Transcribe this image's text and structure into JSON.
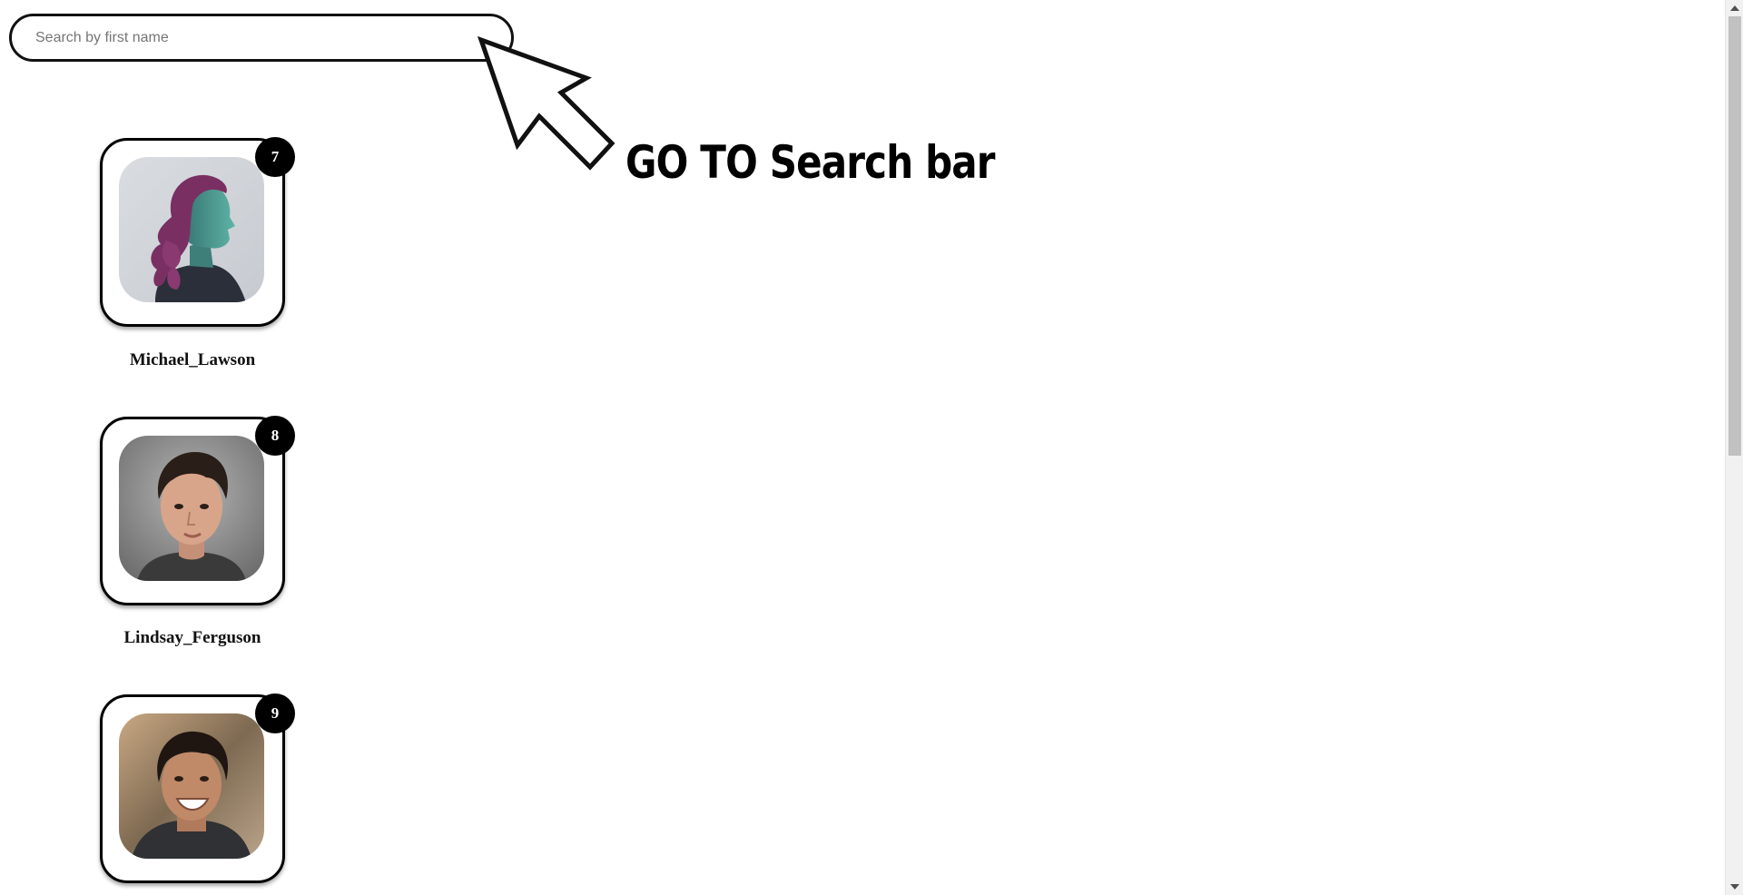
{
  "search": {
    "placeholder": "Search by first name",
    "value": ""
  },
  "annotation": {
    "text": "GO TO Search bar",
    "icon": "pointer-arrow-icon"
  },
  "people": [
    {
      "name": "Michael_Lawson",
      "badge": "7",
      "avatar_icon": "avatar-woman-profile-icon"
    },
    {
      "name": "Lindsay_Ferguson",
      "badge": "8",
      "avatar_icon": "avatar-young-man-icon"
    },
    {
      "name": "",
      "badge": "9",
      "avatar_icon": "avatar-smiling-man-icon"
    }
  ],
  "colors": {
    "border": "#000000",
    "badge_bg": "#000000",
    "badge_text": "#ffffff",
    "background": "#ffffff"
  }
}
